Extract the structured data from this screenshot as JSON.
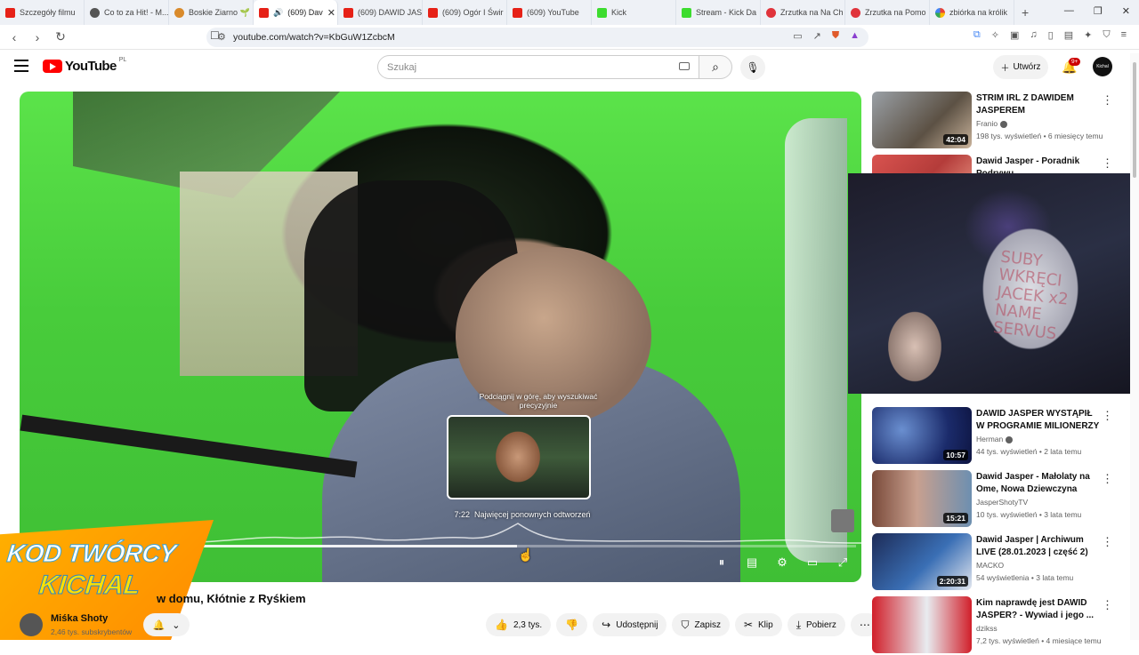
{
  "browser": {
    "tabs": [
      {
        "label": "Szczegóły filmu",
        "icon": "youtube-icon"
      },
      {
        "label": "Co to za Hit! - M...",
        "icon": "globe-icon"
      },
      {
        "label": "Boskie Ziarno 🌱",
        "icon": "site-icon"
      },
      {
        "label": "(609) Dav",
        "icon": "youtube-icon",
        "active": true
      },
      {
        "label": "(609) DAWID JAS",
        "icon": "youtube-icon"
      },
      {
        "label": "(609) Ogór I Świr",
        "icon": "youtube-icon"
      },
      {
        "label": "(609) YouTube",
        "icon": "youtube-icon"
      },
      {
        "label": "Kick",
        "icon": "kick-icon"
      },
      {
        "label": "Stream - Kick Da",
        "icon": "kick-icon"
      },
      {
        "label": "Zrzutka na Na Ch",
        "icon": "zrzutka-icon"
      },
      {
        "label": "Zrzutka na Pomo",
        "icon": "zrzutka-icon"
      },
      {
        "label": "zbiórka na królik",
        "icon": "google-icon"
      }
    ],
    "url": "youtube.com/watch?v=KbGuW1ZcbcM"
  },
  "header": {
    "logo_text": "YouTube",
    "region": "PL",
    "search_placeholder": "Szukaj",
    "create_label": "Utwórz",
    "notif_badge": "9+",
    "avatar_text": "Kichal"
  },
  "player": {
    "hint": "Podciągnij w górę, aby wyszukiwać precyzyjnie",
    "preview_time": "7:22",
    "preview_label": "Najwięcej ponownych odtworzeń",
    "progress_fraction": 0.595
  },
  "banner": {
    "line1": "KOD TWÓRCY",
    "line2": "KICHAL"
  },
  "video": {
    "title": "w domu, Kłótnie z Ryśkiem",
    "channel": "Miśka Shoty",
    "subscribers": "2,46 tys. subskrybentów",
    "likes": "2,3 tys.",
    "share": "Udostępnij",
    "save": "Zapisz",
    "clip": "Klip",
    "download": "Pobierz"
  },
  "recommendations": [
    {
      "title": "STRIM IRL Z DAWIDEM JASPEREM",
      "channel": "Franio",
      "verified": true,
      "meta": "198 tys. wyświetleń • 6 miesięcy temu",
      "duration": "42:04"
    },
    {
      "title": "Dawid Jasper - Poradnik Podrywu",
      "channel": "",
      "verified": false,
      "meta": "",
      "duration": ""
    },
    {
      "title": "DAWID JASPER WYSTĄPIŁ W PROGRAMIE MILIONERZY",
      "channel": "Herman",
      "verified": true,
      "meta": "44 tys. wyświetleń • 2 lata temu",
      "duration": "10:57"
    },
    {
      "title": "Dawid Jasper - Małolaty na Ome, Nowa Dziewczyna",
      "channel": "JasperShotyTV",
      "verified": false,
      "meta": "10 tys. wyświetleń • 3 lata temu",
      "duration": "15:21"
    },
    {
      "title": "Dawid Jasper | Archiwum LIVE (28.01.2023 | część 2)",
      "channel": "MACKO",
      "verified": false,
      "meta": "54 wyświetlenia • 3 lata temu",
      "duration": "2:20:31"
    },
    {
      "title": "Kim naprawdę jest DAWID JASPER? - Wywiad i jego ...",
      "channel": "dzikss",
      "verified": false,
      "meta": "7,2 tys. wyświetleń • 4 miesiące temu",
      "duration": ""
    }
  ],
  "webcam": {
    "board_text": "SUBY WKRĘCI JACEK x2 NAME SERVUS"
  }
}
